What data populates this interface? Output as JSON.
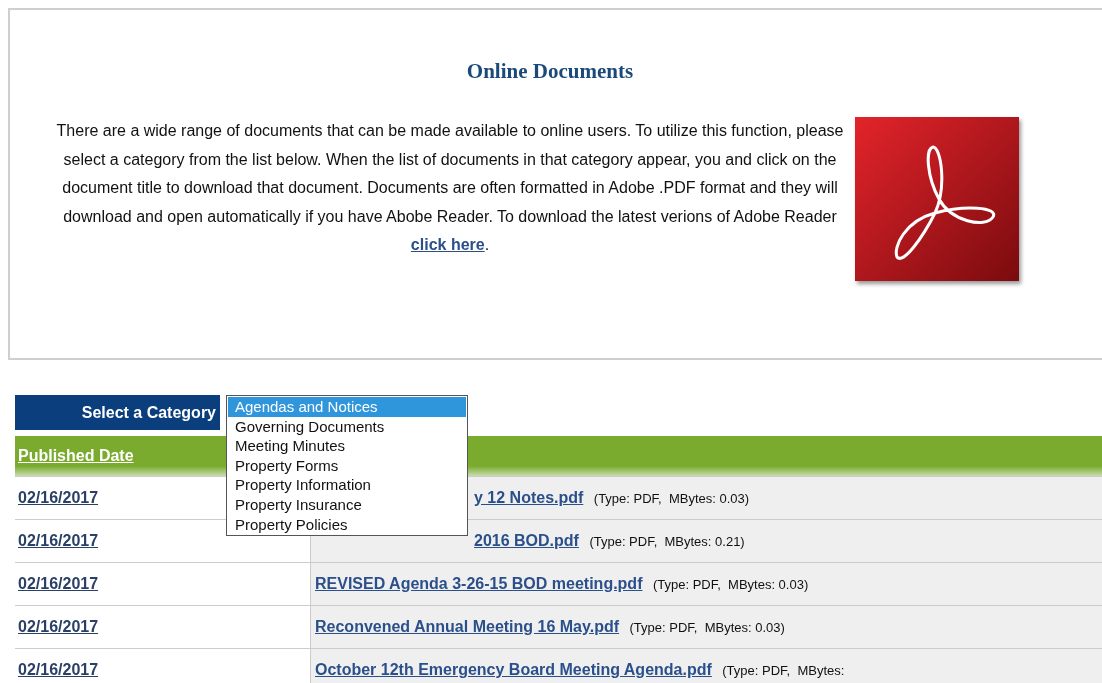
{
  "intro": {
    "title": "Online Documents",
    "text": "There are a wide range of documents that can be made available to online users. To utilize this function, please select a category from the list below. When the list of documents in that category appear, you and click on the document title to download that document. Documents are often formatted in Adobe .PDF format and they will download and open automatically if you have Abobe Reader. To download the latest verions of Adobe Reader",
    "link": "click here",
    "after_link": "."
  },
  "category": {
    "label": "Select a Category",
    "options": [
      {
        "label": "Agendas and Notices",
        "selected": true
      },
      {
        "label": "Governing Documents",
        "selected": false
      },
      {
        "label": "Meeting Minutes",
        "selected": false
      },
      {
        "label": "Property Forms",
        "selected": false
      },
      {
        "label": "Property Information",
        "selected": false
      },
      {
        "label": "Property Insurance",
        "selected": false
      },
      {
        "label": "Property Policies",
        "selected": false
      }
    ]
  },
  "table": {
    "columns": [
      "Published Date"
    ],
    "rows": [
      {
        "date": "02/16/2017",
        "file": "y 12 Notes.pdf",
        "info": "(Type: PDF,  MBytes: 0.03)",
        "covered": true
      },
      {
        "date": "02/16/2017",
        "file": "2016 BOD.pdf",
        "info": "(Type: PDF,  MBytes: 0.21)",
        "covered": true
      },
      {
        "date": "02/16/2017",
        "file": "REVISED Agenda 3-26-15 BOD meeting.pdf",
        "info": "(Type: PDF,  MBytes: 0.03)",
        "covered": false
      },
      {
        "date": "02/16/2017",
        "file": "Reconvened Annual Meeting 16 May.pdf",
        "info": "(Type: PDF,  MBytes: 0.03)",
        "covered": false
      },
      {
        "date": "02/16/2017",
        "file": "October 12th Emergency Board Meeting Agenda.pdf",
        "info": "(Type: PDF,  MBytes:",
        "covered": false
      }
    ]
  }
}
